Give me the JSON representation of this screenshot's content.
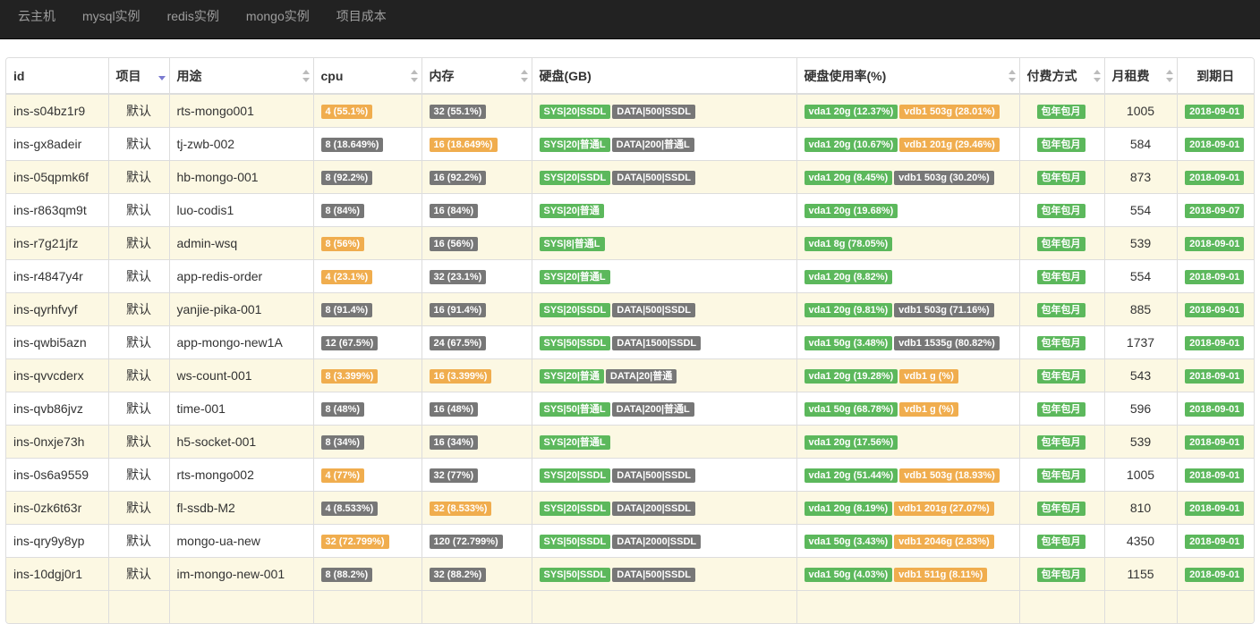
{
  "nav": [
    "云主机",
    "mysql实例",
    "redis实例",
    "mongo实例",
    "项目成本"
  ],
  "columns": [
    {
      "label": "id",
      "sort": "none"
    },
    {
      "label": "项目",
      "sort": "desc"
    },
    {
      "label": "用途",
      "sort": "both"
    },
    {
      "label": "cpu",
      "sort": "both"
    },
    {
      "label": "内存",
      "sort": "both"
    },
    {
      "label": "硬盘(GB)",
      "sort": "none"
    },
    {
      "label": "硬盘使用率(%)",
      "sort": "both"
    },
    {
      "label": "付费方式",
      "sort": "both"
    },
    {
      "label": "月租费",
      "sort": "both"
    },
    {
      "label": "到期日",
      "sort": "none"
    }
  ],
  "colors": {
    "warning": "#f0ad4e",
    "default": "#777777",
    "success": "#5cb85c",
    "row_highlight": "#fcf8e3"
  },
  "rows": [
    {
      "id": "ins-s04bz1r9",
      "project": "默认",
      "purpose": "rts-mongo001",
      "cpu": {
        "text": "4 (55.1%)",
        "style": "warning"
      },
      "mem": {
        "text": "32 (55.1%)",
        "style": "default"
      },
      "disks": [
        {
          "text": "SYS|20|SSDL",
          "style": "success"
        },
        {
          "text": "DATA|500|SSDL",
          "style": "default"
        }
      ],
      "usage": [
        {
          "text": "vda1 20g (12.37%)",
          "style": "success"
        },
        {
          "text": "vdb1 503g (28.01%)",
          "style": "warning"
        }
      ],
      "pay": "包年包月",
      "fee": "1005",
      "expire": "2018-09-01"
    },
    {
      "id": "ins-gx8adeir",
      "project": "默认",
      "purpose": "tj-zwb-002",
      "cpu": {
        "text": "8 (18.649%)",
        "style": "default"
      },
      "mem": {
        "text": "16 (18.649%)",
        "style": "warning"
      },
      "disks": [
        {
          "text": "SYS|20|普通L",
          "style": "success"
        },
        {
          "text": "DATA|200|普通L",
          "style": "default"
        }
      ],
      "usage": [
        {
          "text": "vda1 20g (10.67%)",
          "style": "success"
        },
        {
          "text": "vdb1 201g (29.46%)",
          "style": "warning"
        }
      ],
      "pay": "包年包月",
      "fee": "584",
      "expire": "2018-09-01"
    },
    {
      "id": "ins-05qpmk6f",
      "project": "默认",
      "purpose": "hb-mongo-001",
      "cpu": {
        "text": "8 (92.2%)",
        "style": "default"
      },
      "mem": {
        "text": "16 (92.2%)",
        "style": "default"
      },
      "disks": [
        {
          "text": "SYS|20|SSDL",
          "style": "success"
        },
        {
          "text": "DATA|500|SSDL",
          "style": "default"
        }
      ],
      "usage": [
        {
          "text": "vda1 20g (8.45%)",
          "style": "success"
        },
        {
          "text": "vdb1 503g (30.20%)",
          "style": "default"
        }
      ],
      "pay": "包年包月",
      "fee": "873",
      "expire": "2018-09-01"
    },
    {
      "id": "ins-r863qm9t",
      "project": "默认",
      "purpose": "luo-codis1",
      "cpu": {
        "text": "8 (84%)",
        "style": "default"
      },
      "mem": {
        "text": "16 (84%)",
        "style": "default"
      },
      "disks": [
        {
          "text": "SYS|20|普通",
          "style": "success"
        }
      ],
      "usage": [
        {
          "text": "vda1 20g (19.68%)",
          "style": "success"
        }
      ],
      "pay": "包年包月",
      "fee": "554",
      "expire": "2018-09-07"
    },
    {
      "id": "ins-r7g21jfz",
      "project": "默认",
      "purpose": "admin-wsq",
      "cpu": {
        "text": "8 (56%)",
        "style": "warning"
      },
      "mem": {
        "text": "16 (56%)",
        "style": "default"
      },
      "disks": [
        {
          "text": "SYS|8|普通L",
          "style": "success"
        }
      ],
      "usage": [
        {
          "text": "vda1 8g (78.05%)",
          "style": "success"
        }
      ],
      "pay": "包年包月",
      "fee": "539",
      "expire": "2018-09-01"
    },
    {
      "id": "ins-r4847y4r",
      "project": "默认",
      "purpose": "app-redis-order",
      "cpu": {
        "text": "4 (23.1%)",
        "style": "warning"
      },
      "mem": {
        "text": "32 (23.1%)",
        "style": "default"
      },
      "disks": [
        {
          "text": "SYS|20|普通L",
          "style": "success"
        }
      ],
      "usage": [
        {
          "text": "vda1 20g (8.82%)",
          "style": "success"
        }
      ],
      "pay": "包年包月",
      "fee": "554",
      "expire": "2018-09-01"
    },
    {
      "id": "ins-qyrhfvyf",
      "project": "默认",
      "purpose": "yanjie-pika-001",
      "cpu": {
        "text": "8 (91.4%)",
        "style": "default"
      },
      "mem": {
        "text": "16 (91.4%)",
        "style": "default"
      },
      "disks": [
        {
          "text": "SYS|20|SSDL",
          "style": "success"
        },
        {
          "text": "DATA|500|SSDL",
          "style": "default"
        }
      ],
      "usage": [
        {
          "text": "vda1 20g (9.81%)",
          "style": "success"
        },
        {
          "text": "vdb1 503g (71.16%)",
          "style": "default"
        }
      ],
      "pay": "包年包月",
      "fee": "885",
      "expire": "2018-09-01"
    },
    {
      "id": "ins-qwbi5azn",
      "project": "默认",
      "purpose": "app-mongo-new1A",
      "cpu": {
        "text": "12 (67.5%)",
        "style": "default"
      },
      "mem": {
        "text": "24 (67.5%)",
        "style": "default"
      },
      "disks": [
        {
          "text": "SYS|50|SSDL",
          "style": "success"
        },
        {
          "text": "DATA|1500|SSDL",
          "style": "default"
        }
      ],
      "usage": [
        {
          "text": "vda1 50g (3.48%)",
          "style": "success"
        },
        {
          "text": "vdb1 1535g (80.82%)",
          "style": "default"
        }
      ],
      "pay": "包年包月",
      "fee": "1737",
      "expire": "2018-09-01"
    },
    {
      "id": "ins-qvvcderx",
      "project": "默认",
      "purpose": "ws-count-001",
      "cpu": {
        "text": "8 (3.399%)",
        "style": "warning"
      },
      "mem": {
        "text": "16 (3.399%)",
        "style": "warning"
      },
      "disks": [
        {
          "text": "SYS|20|普通",
          "style": "success"
        },
        {
          "text": "DATA|20|普通",
          "style": "default"
        }
      ],
      "usage": [
        {
          "text": "vda1 20g (19.28%)",
          "style": "success"
        },
        {
          "text": "vdb1 g (%)",
          "style": "warning"
        }
      ],
      "pay": "包年包月",
      "fee": "543",
      "expire": "2018-09-01"
    },
    {
      "id": "ins-qvb86jvz",
      "project": "默认",
      "purpose": "time-001",
      "cpu": {
        "text": "8 (48%)",
        "style": "default"
      },
      "mem": {
        "text": "16 (48%)",
        "style": "default"
      },
      "disks": [
        {
          "text": "SYS|50|普通L",
          "style": "success"
        },
        {
          "text": "DATA|200|普通L",
          "style": "default"
        }
      ],
      "usage": [
        {
          "text": "vda1 50g (68.78%)",
          "style": "success"
        },
        {
          "text": "vdb1 g (%)",
          "style": "warning"
        }
      ],
      "pay": "包年包月",
      "fee": "596",
      "expire": "2018-09-01"
    },
    {
      "id": "ins-0nxje73h",
      "project": "默认",
      "purpose": "h5-socket-001",
      "cpu": {
        "text": "8 (34%)",
        "style": "default"
      },
      "mem": {
        "text": "16 (34%)",
        "style": "default"
      },
      "disks": [
        {
          "text": "SYS|20|普通L",
          "style": "success"
        }
      ],
      "usage": [
        {
          "text": "vda1 20g (17.56%)",
          "style": "success"
        }
      ],
      "pay": "包年包月",
      "fee": "539",
      "expire": "2018-09-01"
    },
    {
      "id": "ins-0s6a9559",
      "project": "默认",
      "purpose": "rts-mongo002",
      "cpu": {
        "text": "4 (77%)",
        "style": "warning"
      },
      "mem": {
        "text": "32 (77%)",
        "style": "default"
      },
      "disks": [
        {
          "text": "SYS|20|SSDL",
          "style": "success"
        },
        {
          "text": "DATA|500|SSDL",
          "style": "default"
        }
      ],
      "usage": [
        {
          "text": "vda1 20g (51.44%)",
          "style": "success"
        },
        {
          "text": "vdb1 503g (18.93%)",
          "style": "warning"
        }
      ],
      "pay": "包年包月",
      "fee": "1005",
      "expire": "2018-09-01"
    },
    {
      "id": "ins-0zk6t63r",
      "project": "默认",
      "purpose": "fl-ssdb-M2",
      "cpu": {
        "text": "4 (8.533%)",
        "style": "default"
      },
      "mem": {
        "text": "32 (8.533%)",
        "style": "warning"
      },
      "disks": [
        {
          "text": "SYS|20|SSDL",
          "style": "success"
        },
        {
          "text": "DATA|200|SSDL",
          "style": "default"
        }
      ],
      "usage": [
        {
          "text": "vda1 20g (8.19%)",
          "style": "success"
        },
        {
          "text": "vdb1 201g (27.07%)",
          "style": "warning"
        }
      ],
      "pay": "包年包月",
      "fee": "810",
      "expire": "2018-09-01"
    },
    {
      "id": "ins-qry9y8yp",
      "project": "默认",
      "purpose": "mongo-ua-new",
      "cpu": {
        "text": "32 (72.799%)",
        "style": "warning"
      },
      "mem": {
        "text": "120 (72.799%)",
        "style": "default"
      },
      "disks": [
        {
          "text": "SYS|50|SSDL",
          "style": "success"
        },
        {
          "text": "DATA|2000|SSDL",
          "style": "default"
        }
      ],
      "usage": [
        {
          "text": "vda1 50g (3.43%)",
          "style": "success"
        },
        {
          "text": "vdb1 2046g (2.83%)",
          "style": "warning"
        }
      ],
      "pay": "包年包月",
      "fee": "4350",
      "expire": "2018-09-01"
    },
    {
      "id": "ins-10dgj0r1",
      "project": "默认",
      "purpose": "im-mongo-new-001",
      "cpu": {
        "text": "8 (88.2%)",
        "style": "default"
      },
      "mem": {
        "text": "32 (88.2%)",
        "style": "default"
      },
      "disks": [
        {
          "text": "SYS|50|SSDL",
          "style": "success"
        },
        {
          "text": "DATA|500|SSDL",
          "style": "default"
        }
      ],
      "usage": [
        {
          "text": "vda1 50g (4.03%)",
          "style": "success"
        },
        {
          "text": "vdb1 511g (8.11%)",
          "style": "warning"
        }
      ],
      "pay": "包年包月",
      "fee": "1155",
      "expire": "2018-09-01"
    }
  ]
}
